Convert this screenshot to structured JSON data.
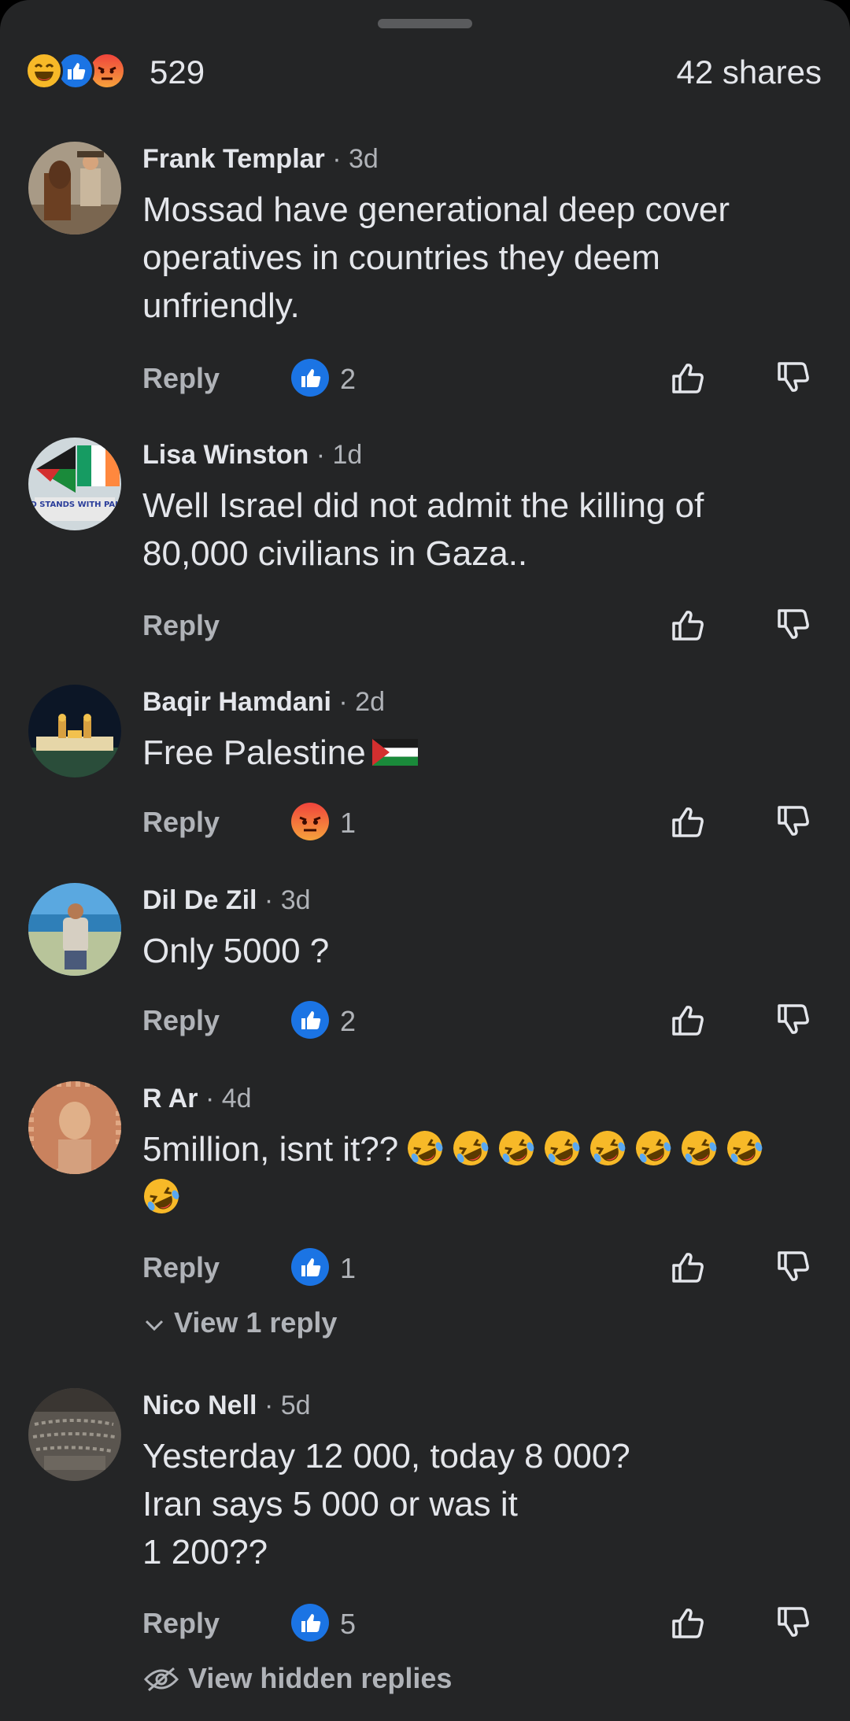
{
  "summary": {
    "reaction_icons": [
      "haha-icon",
      "like-icon",
      "angry-icon"
    ],
    "reaction_count": "529",
    "shares": "42 shares"
  },
  "actions": {
    "reply_label": "Reply"
  },
  "comments": [
    {
      "author": "Frank Templar",
      "time": "· 3d",
      "lines": [
        "Mossad have generational deep cover",
        "operatives in countries they deem",
        "unfriendly."
      ],
      "reaction": "like",
      "reaction_count": "2"
    },
    {
      "author": "Lisa Winston",
      "time": "· 1d",
      "lines": [
        "Well Israel did not admit the killing of",
        "80,000 civilians in Gaza.."
      ],
      "reaction": "",
      "reaction_count": "",
      "avatar_banner_text": "IRELAND STANDS WITH PALESTINE"
    },
    {
      "author": "Baqir Hamdani",
      "time": "· 2d",
      "lines": [
        "Free Palestine"
      ],
      "reaction": "angry",
      "reaction_count": "1",
      "inline_emoji": "palestine-flag"
    },
    {
      "author": "Dil De Zil",
      "time": "· 3d",
      "lines": [
        "Only 5000 ?"
      ],
      "reaction": "like",
      "reaction_count": "2"
    },
    {
      "author": "R Ar",
      "time": "· 4d",
      "lines": [
        "5million, isnt it??"
      ],
      "reaction": "like",
      "reaction_count": "1",
      "inline_emoji": "rolling-laughing",
      "inline_emoji_count": 9,
      "view_replies": "View 1 reply"
    },
    {
      "author": "Nico Nell",
      "time": "· 5d",
      "lines": [
        "Yesterday 12 000, today 8 000?",
        "Iran says 5 000 or was it",
        "1 200??"
      ],
      "reaction": "like",
      "reaction_count": "5",
      "view_hidden": "View hidden replies"
    }
  ],
  "colors": {
    "background": "#242526",
    "text": "#e4e6eb",
    "secondary": "#b0b3b8",
    "like_blue": "#1b74e4"
  }
}
